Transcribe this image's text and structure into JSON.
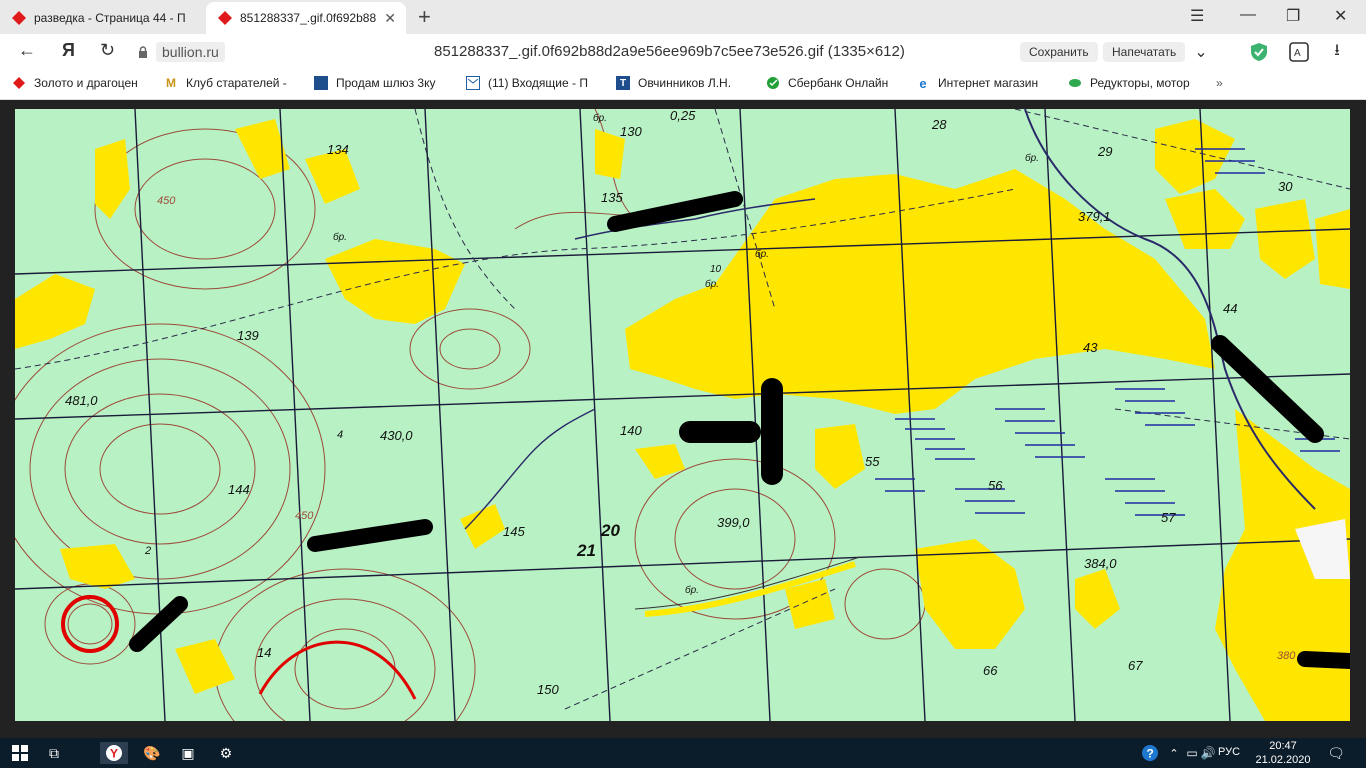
{
  "tabs": [
    {
      "title": "разведка - Страница 44 - П"
    },
    {
      "title": "851288337_.gif.0f692b88"
    }
  ],
  "address": {
    "domain": "bullion.ru",
    "page_title": "851288337_.gif.0f692b88d2a9e56ee969b7c5ee73e526.gif (1335×612)",
    "save_label": "Сохранить",
    "print_label": "Напечатать"
  },
  "bookmarks": [
    {
      "label": "Золото и драгоцен",
      "icon": "red-diamond-icon"
    },
    {
      "label": "Клуб старателей -",
      "icon": "m-logo-icon"
    },
    {
      "label": "Продам шлюз 3ку",
      "icon": "site-icon"
    },
    {
      "label": "(11) Входящие - П",
      "icon": "mail-icon"
    },
    {
      "label": "Овчинников Л.Н.",
      "icon": "t-logo-icon"
    },
    {
      "label": "Сбербанк Онлайн",
      "icon": "sber-icon"
    },
    {
      "label": "Интернет магазин",
      "icon": "ie-icon"
    },
    {
      "label": "Редукторы, мотор",
      "icon": "leaf-icon"
    }
  ],
  "map_labels": {
    "l134": "134",
    "l130": "130",
    "l025": "0,25",
    "l28": "28",
    "l29": "29",
    "l30": "30",
    "l135": "135",
    "l3791": "379,1",
    "l44": "44",
    "l43": "43",
    "l139": "139",
    "l4810": "481,0",
    "l4300": "430,0",
    "l140": "140",
    "l55": "55",
    "l56": "56",
    "l144": "144",
    "l145": "145",
    "l21": "21",
    "l20": "20",
    "l3990": "399,0",
    "l57": "57",
    "l3840": "384,0",
    "l150": "150",
    "l66": "66",
    "l67": "67",
    "l380": "380",
    "l450a": "450",
    "l450b": "450",
    "l14": "14",
    "l4": "4",
    "l2": "2",
    "br1": "бр.",
    "br2": "бр.",
    "br3": "бр.",
    "br4": "бр.",
    "br5": "бр.",
    "br6": "бр.",
    "l10a": "10"
  },
  "taskbar": {
    "lang": "РУС",
    "time": "20:47",
    "date": "21.02.2020"
  },
  "colors": {
    "map_background": "#b8f2c4",
    "sand": "#ffe600",
    "contour": "#9c4a3a",
    "grid": "#1a1a3a"
  }
}
